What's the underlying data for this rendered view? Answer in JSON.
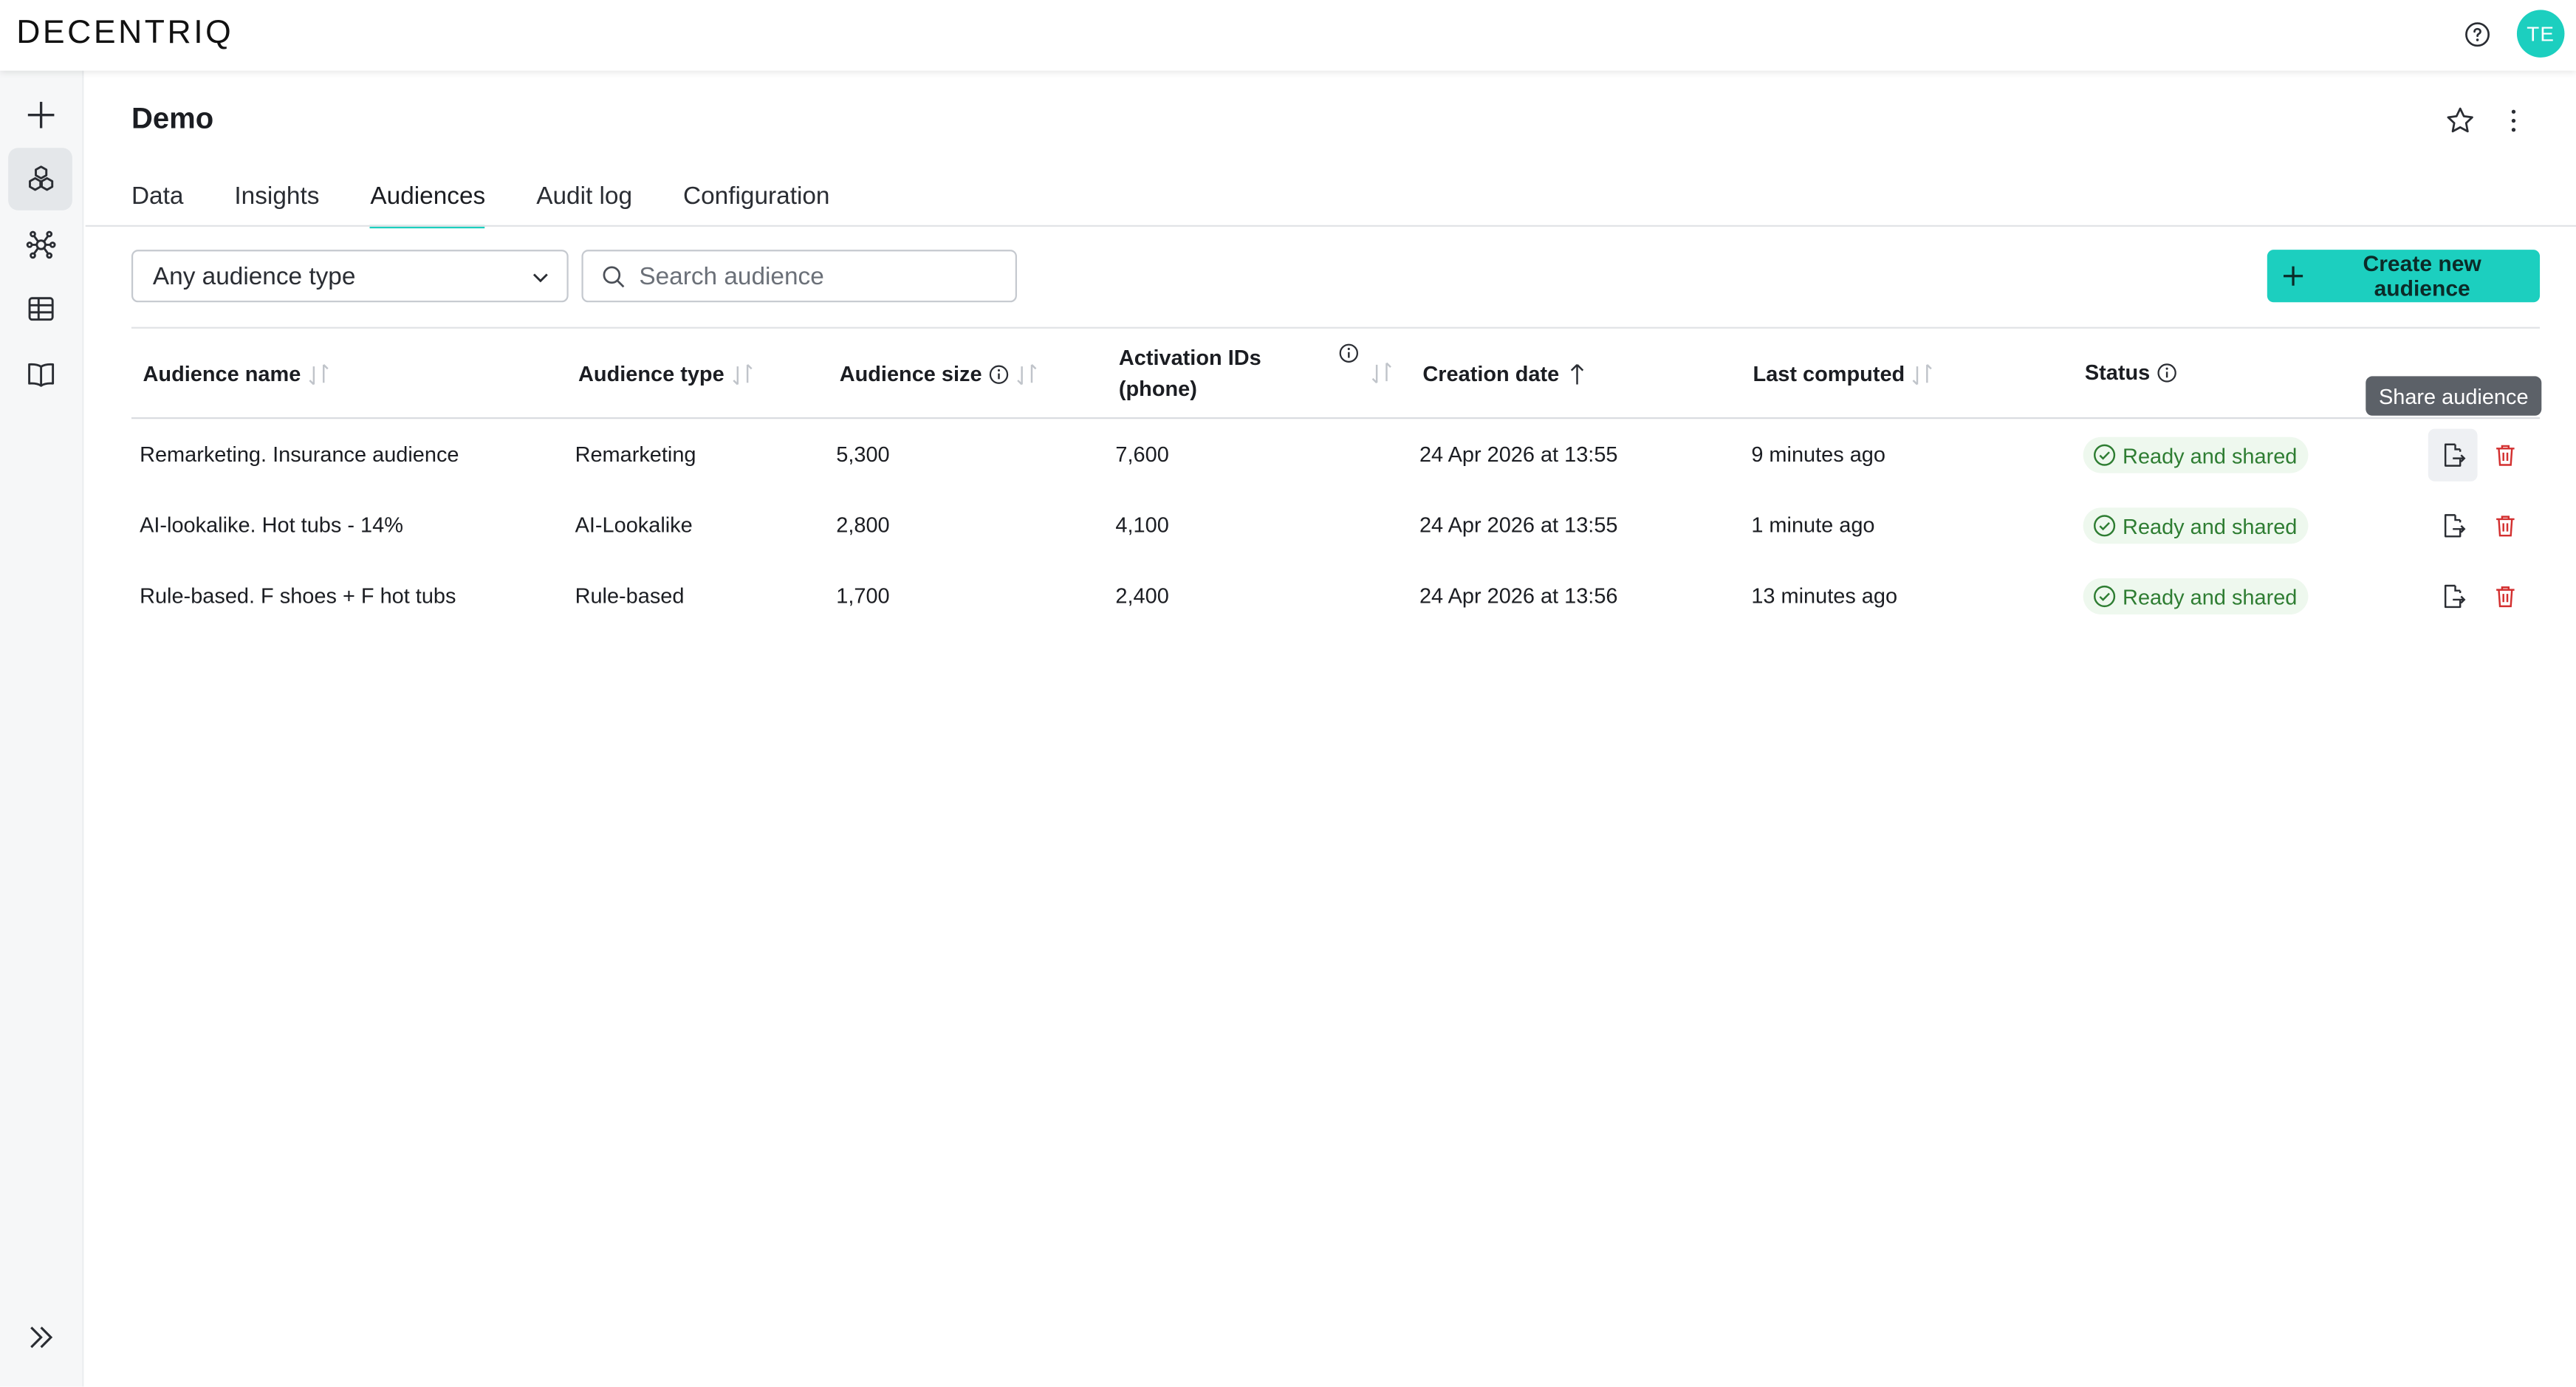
{
  "app": {
    "logo_text": "DECENTRIQ",
    "avatar_initials": "TE"
  },
  "page": {
    "title": "Demo"
  },
  "tabs": [
    {
      "label": "Data",
      "active": false
    },
    {
      "label": "Insights",
      "active": false
    },
    {
      "label": "Audiences",
      "active": true
    },
    {
      "label": "Audit log",
      "active": false
    },
    {
      "label": "Configuration",
      "active": false
    }
  ],
  "filters": {
    "audience_type_selected": "Any audience type",
    "search_placeholder": "Search audience",
    "search_value": ""
  },
  "toolbar": {
    "create_label": "Create new audience"
  },
  "table": {
    "columns": {
      "name": "Audience name",
      "type": "Audience type",
      "size": "Audience size",
      "activation_line1": "Activation IDs",
      "activation_line2": "(phone)",
      "created": "Creation date",
      "computed": "Last computed",
      "status": "Status"
    },
    "sorted_column": "Creation date",
    "rows": [
      {
        "name": "Remarketing. Insurance audience",
        "type": "Remarketing",
        "size": "5,300",
        "activation_ids": "7,600",
        "created": "24 Apr 2026 at 13:55",
        "computed": "9 minutes ago",
        "status": "Ready and shared"
      },
      {
        "name": "AI-lookalike. Hot tubs - 14%",
        "type": "AI-Lookalike",
        "size": "2,800",
        "activation_ids": "4,100",
        "created": "24 Apr 2026 at 13:55",
        "computed": "1 minute ago",
        "status": "Ready and shared"
      },
      {
        "name": "Rule-based. F shoes + F hot tubs",
        "type": "Rule-based",
        "size": "1,700",
        "activation_ids": "2,400",
        "created": "24 Apr 2026 at 13:56",
        "computed": "13 minutes ago",
        "status": "Ready and shared"
      }
    ]
  },
  "tooltip": {
    "text": "Share audience"
  },
  "colors": {
    "accent": "#1ccfbf",
    "success": "#2e7d32",
    "danger": "#d32f2f"
  },
  "icons": {
    "sidebar": [
      "plus-icon",
      "cubes-icon",
      "network-icon",
      "table-icon",
      "book-icon"
    ],
    "header": [
      "help-icon",
      "star-icon",
      "more-vertical-icon"
    ],
    "row_actions": [
      "share-icon",
      "trash-icon"
    ]
  }
}
